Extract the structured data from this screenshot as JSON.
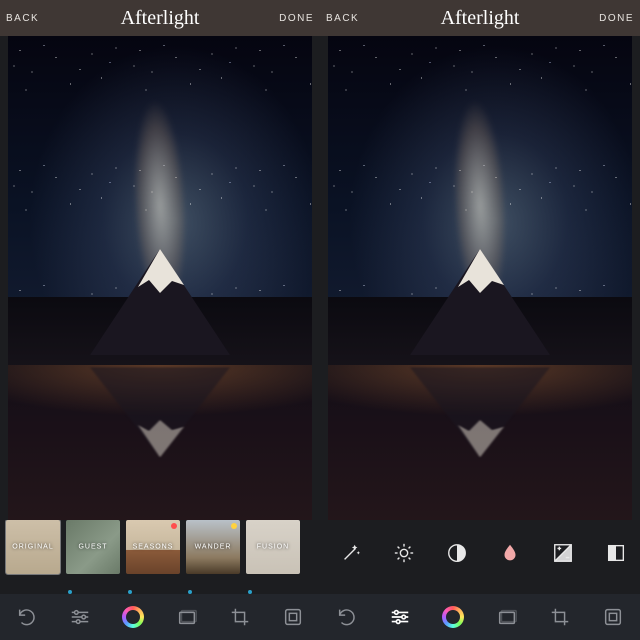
{
  "app": {
    "brand": "Afterlight"
  },
  "header": {
    "back": "BACK",
    "done": "DONE"
  },
  "left": {
    "filters": [
      {
        "id": "original",
        "label": "ORIGINAL",
        "dot": false,
        "badge": null,
        "selected": true
      },
      {
        "id": "guest",
        "label": "GUEST",
        "dot": true,
        "badge": null,
        "selected": false
      },
      {
        "id": "seasons",
        "label": "SEASONS",
        "dot": true,
        "badge": "#ff4d4d",
        "selected": false
      },
      {
        "id": "wander",
        "label": "WANDER",
        "dot": true,
        "badge": "#ffd23f",
        "selected": false
      },
      {
        "id": "fusion",
        "label": "FUSION",
        "dot": true,
        "badge": null,
        "selected": false
      }
    ],
    "toolbar": {
      "active": "filters",
      "items": [
        "undo",
        "adjust",
        "filters",
        "textures",
        "crop",
        "frames"
      ]
    }
  },
  "right": {
    "adjust": {
      "active": "saturation",
      "items": [
        {
          "id": "clarify",
          "icon": "wand-icon"
        },
        {
          "id": "brightness",
          "icon": "sun-icon"
        },
        {
          "id": "contrast",
          "icon": "contrast-icon"
        },
        {
          "id": "saturation",
          "icon": "drop-icon"
        },
        {
          "id": "exposure",
          "icon": "exposure-icon"
        },
        {
          "id": "highlights",
          "icon": "highlights-icon"
        },
        {
          "id": "shadows",
          "icon": "shadows-icon"
        }
      ]
    },
    "toolbar": {
      "active": "adjust",
      "items": [
        "undo",
        "adjust",
        "filters",
        "textures",
        "crop",
        "frames"
      ]
    }
  }
}
